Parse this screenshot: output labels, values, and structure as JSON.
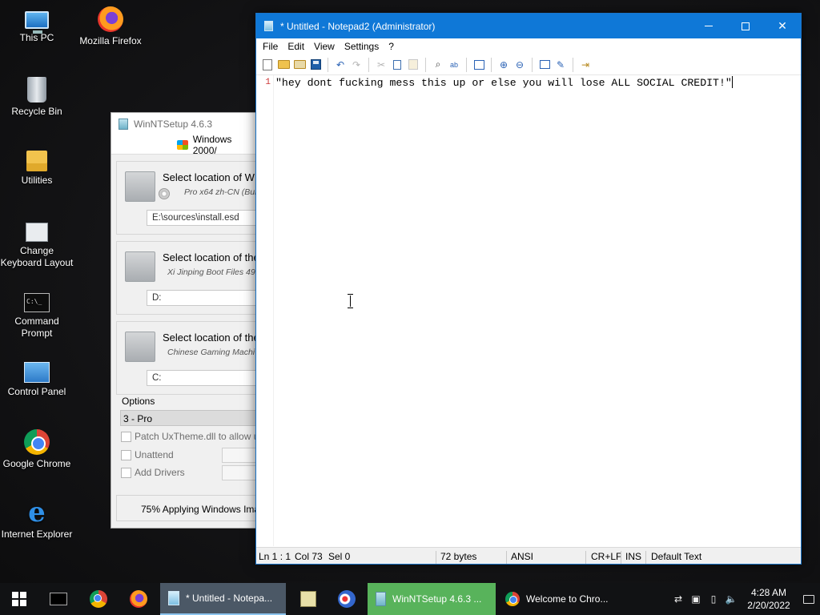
{
  "desktop": {
    "icons": [
      {
        "label": "This PC",
        "icon": "computer-icon"
      },
      {
        "label": "Mozilla Firefox",
        "icon": "firefox-icon"
      },
      {
        "label": "Recycle Bin",
        "icon": "recycle-bin-icon"
      },
      {
        "label": "Utilities",
        "icon": "folder-icon"
      },
      {
        "label": "Change Keyboard Layout",
        "icon": "keyboard-settings-icon"
      },
      {
        "label": "Command Prompt",
        "icon": "command-prompt-icon"
      },
      {
        "label": "Control Panel",
        "icon": "control-panel-icon"
      },
      {
        "label": "Google Chrome",
        "icon": "chrome-icon"
      },
      {
        "label": "Internet Explorer",
        "icon": "internet-explorer-icon"
      }
    ]
  },
  "winntsetup": {
    "title": "WinNTSetup 4.6.3",
    "os_tab": "Windows 2000/",
    "groups": [
      {
        "title": "Select location of W",
        "subtitle": "Pro  x64 zh-CN (Buil",
        "field": "E:\\sources\\install.esd"
      },
      {
        "title": "Select location of the",
        "subtitle": "Xi Jinping Boot Files 49",
        "field": "D:"
      },
      {
        "title": "Select location of the",
        "subtitle": "Chinese Gaming Machi",
        "field": "C:"
      }
    ],
    "options_label": "Options",
    "edition": "3 - Pro",
    "checkboxes": [
      "Patch UxTheme.dll to allow u",
      "Unattend",
      "Add Drivers"
    ],
    "status": "75% Applying Windows Ima"
  },
  "notepad": {
    "title": "* Untitled - Notepad2 (Administrator)",
    "menu": [
      "File",
      "Edit",
      "View",
      "Settings",
      "?"
    ],
    "line_number": "1",
    "content": "\"hey dont fucking mess this up or else you will lose ALL SOCIAL CREDIT!\"",
    "status": {
      "position": "Ln 1 : 1",
      "col": "Col 73",
      "sel": "Sel 0",
      "size": "72 bytes",
      "encoding": "ANSI",
      "eol": "CR+LF",
      "mode": "INS",
      "scheme": "Default Text"
    }
  },
  "taskbar": {
    "tasks": [
      {
        "label": "* Untitled - Notepa...",
        "icon": "notepad2-icon"
      },
      {
        "label": "WinNTSetup 4.6.3    ...",
        "icon": "winntsetup-icon"
      },
      {
        "label": "Welcome to Chro...",
        "icon": "chrome-icon"
      }
    ],
    "clock_time": "4:28 AM",
    "clock_date": "2/20/2022"
  },
  "colors": {
    "notepad_titlebar": "#0f78d7",
    "taskbar": "#111214",
    "winnt_task": "#58b35b"
  }
}
